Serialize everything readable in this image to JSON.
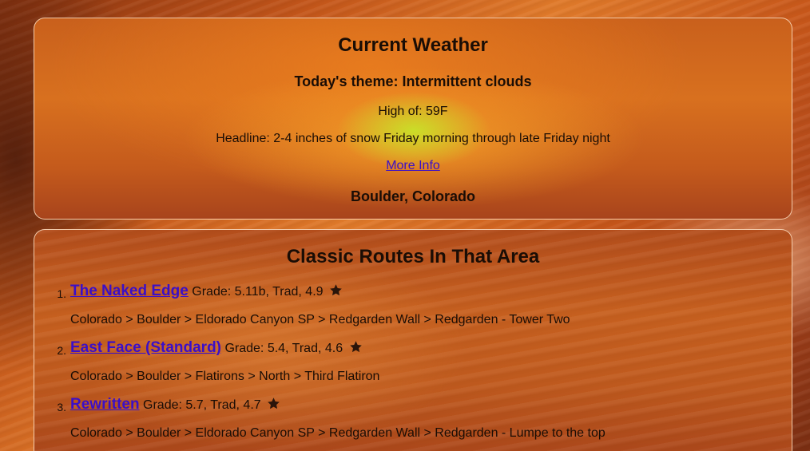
{
  "weather": {
    "title": "Current Weather",
    "theme": "Today's theme: Intermittent clouds",
    "high": "High of: 59F",
    "headline": "Headline: 2-4 inches of snow Friday morning through late Friday night",
    "more_info": "More Info",
    "location": "Boulder, Colorado"
  },
  "routes": {
    "title": "Classic Routes In That Area",
    "items": [
      {
        "number": "1.",
        "name": "The Naked Edge",
        "meta": "Grade: 5.11b, Trad, 4.9",
        "path": "Colorado > Boulder > Eldorado Canyon SP > Redgarden Wall > Redgarden - Tower Two"
      },
      {
        "number": "2.",
        "name": "East Face (Standard)",
        "meta": "Grade: 5.4, Trad, 4.6",
        "path": "Colorado > Boulder > Flatirons > North > Third Flatiron"
      },
      {
        "number": "3.",
        "name": "Rewritten",
        "meta": "Grade: 5.7, Trad, 4.7",
        "path": "Colorado > Boulder > Eldorado Canyon SP > Redgarden Wall > Redgarden - Lumpe to the top"
      }
    ]
  },
  "icons": {
    "rating": "star-icon"
  },
  "colors": {
    "link": "#3b0fc8",
    "text": "#1a0d05",
    "card_border": "#ffe1c3"
  }
}
